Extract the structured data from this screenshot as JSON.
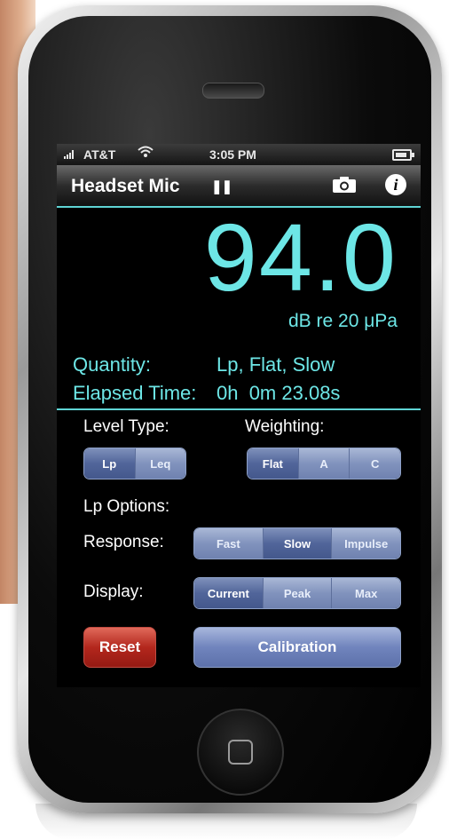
{
  "status_bar": {
    "carrier": "AT&T",
    "time": "3:05 PM",
    "signal_icon": "signal-bars-icon",
    "wifi_icon": "wifi-icon",
    "battery_icon": "battery-icon"
  },
  "nav": {
    "title": "Headset Mic",
    "pause_symbol": "❚❚",
    "camera_icon": "camera-icon",
    "info_symbol": "i"
  },
  "meter": {
    "reading": "94.0",
    "unit": "dB re 20 μPa"
  },
  "info": {
    "quantity_label": "Quantity:",
    "quantity_value": "Lp, Flat, Slow",
    "elapsed_label": "Elapsed Time:",
    "elapsed_value": "0h  0m 23.08s"
  },
  "controls": {
    "level_type_label": "Level Type:",
    "level_type_options": [
      "Lp",
      "Leq"
    ],
    "level_type_selected": "Lp",
    "weighting_label": "Weighting:",
    "weighting_options": [
      "Flat",
      "A",
      "C"
    ],
    "weighting_selected": "Flat",
    "lp_options_label": "Lp Options:",
    "response_label": "Response:",
    "response_options": [
      "Fast",
      "Slow",
      "Impulse"
    ],
    "response_selected": "Slow",
    "display_label": "Display:",
    "display_options": [
      "Current",
      "Peak",
      "Max"
    ],
    "display_selected": "Current",
    "reset_label": "Reset",
    "calibration_label": "Calibration"
  },
  "colors": {
    "accent_cyan": "#6de6e6",
    "segment_blue": "#7084bd",
    "reset_red": "#b3271d"
  }
}
